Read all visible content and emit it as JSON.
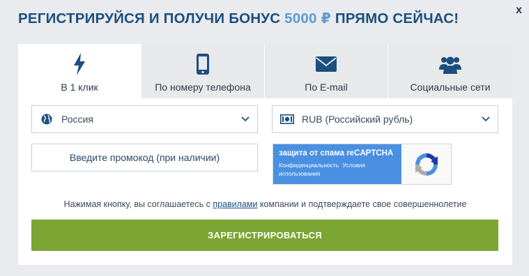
{
  "header": {
    "title_part1": "РЕГИСТРИРУЙСЯ И ПОЛУЧИ БОНУС ",
    "title_bonus": "5000 ₽",
    "title_part2": " ПРЯМО СЕЙЧАС!",
    "close_label": "x"
  },
  "tabs": [
    {
      "label": "В 1 клик",
      "icon": "lightning-icon",
      "active": true
    },
    {
      "label": "По номеру телефона",
      "icon": "phone-icon",
      "active": false
    },
    {
      "label": "По E-mail",
      "icon": "envelope-icon",
      "active": false
    },
    {
      "label": "Социальные сети",
      "icon": "people-icon",
      "active": false
    }
  ],
  "form": {
    "country": {
      "value": "Россия",
      "icon": "globe-icon"
    },
    "currency": {
      "value": "RUB (Российский рубль)",
      "icon": "banknote-icon"
    },
    "promo": {
      "placeholder": "Введите промокод (при наличии)"
    },
    "recaptcha": {
      "title": "защита от спама reCAPTCHA",
      "privacy": "Конфиденциальность",
      "terms": "Условия",
      "usage": "использования"
    },
    "agreement": {
      "before": "Нажимая кнопку, вы соглашаетесь с ",
      "link": "правилами",
      "after": " компании и подтверждаете свое совершеннолетие"
    },
    "submit_label": "ЗАРЕГИСТРИРОВАТЬСЯ"
  },
  "colors": {
    "title": "#1b4f7f",
    "bonus": "#5b9bd5",
    "submit": "#7ba633",
    "recaptcha": "#4a90e2"
  }
}
